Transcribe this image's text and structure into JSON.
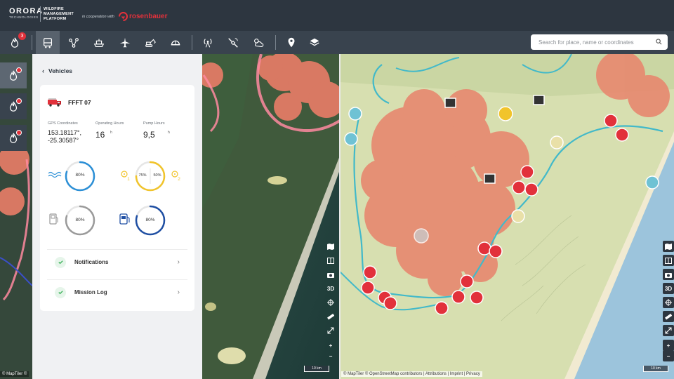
{
  "header": {
    "logo_main": "ORORA",
    "logo_sub": "TECHNOLOGIES",
    "platform_line1": "WILDFIRE",
    "platform_line2": "MANAGEMENT",
    "platform_line3": "PLATFORM",
    "coop_text": "in cooperation with",
    "partner_name": "rosenbauer"
  },
  "toolbar": {
    "fires_badge": "3",
    "tools": [
      "fire-alerts",
      "vehicles",
      "network",
      "boats",
      "aircraft",
      "excavator",
      "personnel",
      "signal",
      "satellite",
      "weather",
      "location",
      "layers"
    ]
  },
  "search": {
    "placeholder": "Search for place, name or coordinates"
  },
  "panel": {
    "back_label": "Vehicles",
    "vehicle_name": "FFFT 07",
    "gps_label": "GPS Coordinates",
    "gps_line1": "153.18117°,",
    "gps_line2": "-25.30587°",
    "hours_label": "Operating Hours",
    "hours_value": "16",
    "hours_unit": "h",
    "pump_label": "Pump Hours",
    "pump_value": "9,5",
    "pump_unit": "h",
    "water_level": "80%",
    "foam1_level": "75%",
    "foam2_level": "50%",
    "foam1_index": "1",
    "foam2_index": "2",
    "fuel_level": "80%",
    "adblue_level": "80%",
    "notifications_label": "Notifications",
    "mission_log_label": "Mission Log"
  },
  "gauges": {
    "water": 0.8,
    "foam1": 0.75,
    "foam2": 0.5,
    "fuel": 0.8,
    "adblue": 0.8
  },
  "colors": {
    "water": "#2b8fd6",
    "foam": "#f1c42b",
    "fuel": "#9a9a9a",
    "adblue": "#1f4fa3",
    "alert": "#e2313b"
  },
  "map_controls": {
    "three_d": "3D",
    "zoom_in": "+",
    "zoom_out": "−",
    "scale_left": "10 km",
    "scale_right": "10 km"
  },
  "attribution": {
    "left": "© MapTiler ©",
    "right": "© MapTiler © OpenStreetMap contributors | Attributions | Imprint | Privacy"
  }
}
